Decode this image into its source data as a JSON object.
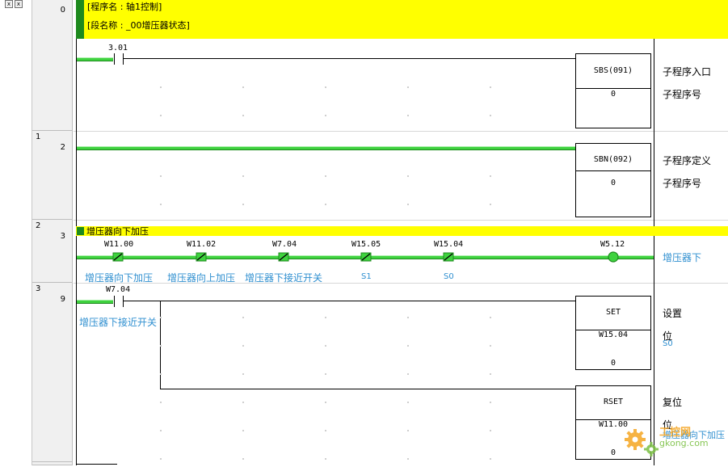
{
  "colors": {
    "rung_green": "#3fd23f",
    "header_yellow": "#ffff00",
    "comment_blue": "#2f8fd0",
    "gray_bg": "#f0f0f0"
  },
  "topleft": {
    "btn1": "x",
    "btn2": "x"
  },
  "rungs": [
    {
      "index": "0",
      "step": "0"
    },
    {
      "index": "1",
      "step": "2"
    },
    {
      "index": "2",
      "step": "3"
    },
    {
      "index": "3",
      "step": "9"
    }
  ],
  "header": {
    "program_name": "[程序名 : 轴1控制]",
    "section_name": "[段名称 : _00增压器状态]"
  },
  "rung0": {
    "contact_addr": "3.01",
    "box_title": "SBS(091)",
    "box_value": "0",
    "label1": "子程序入口",
    "label2": "子程序号"
  },
  "rung1": {
    "box_title": "SBN(092)",
    "box_value": "0",
    "label1": "子程序定义",
    "label2": "子程序号"
  },
  "rung2": {
    "comment": "增压器向下加压",
    "contacts": [
      {
        "addr": "W11.00",
        "comment": "增压器向下加压"
      },
      {
        "addr": "W11.02",
        "comment": "增压器向上加压"
      },
      {
        "addr": "W7.04",
        "comment": "增压器下接近开关"
      },
      {
        "addr": "W15.05",
        "comment": "S1"
      },
      {
        "addr": "W15.04",
        "comment": "S0"
      }
    ],
    "coil_addr": "W5.12",
    "coil_comment": "增压器下"
  },
  "rung3": {
    "contact_addr": "W7.04",
    "contact_comment": "增压器下接近开关",
    "set_box": {
      "title": "SET",
      "operand": "W15.04",
      "value": "0",
      "label1": "设置",
      "label2": "位",
      "comment": "S0"
    },
    "rset_box": {
      "title": "RSET",
      "operand": "W11.00",
      "value": "0",
      "label1": "复位",
      "label2": "位",
      "comment": "增压器向下加压"
    }
  },
  "watermark": {
    "text1": "工控网",
    "text2": "gkong.com"
  }
}
